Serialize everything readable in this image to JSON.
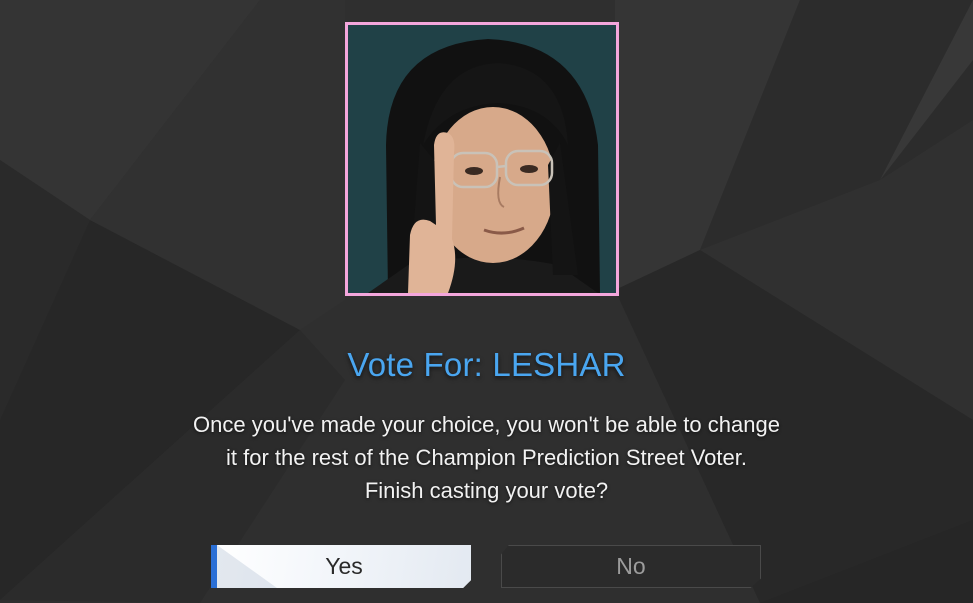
{
  "dialog": {
    "title": "Vote For: LESHAR",
    "message_lines": [
      "Once you've made your choice, you won't be able to change",
      "it for the rest of the Champion Prediction Street Voter.",
      "Finish casting your vote?"
    ],
    "buttons": {
      "yes_label": "Yes",
      "no_label": "No"
    }
  },
  "colors": {
    "background": "#2f2f2f",
    "title_accent": "#4aa6f0",
    "portrait_border": "#f4a6dc",
    "yes_button_bg": "#f4f7fb",
    "yes_button_accent": "#2a6fd6",
    "no_button_bg": "#2b2b2b"
  },
  "portrait": {
    "icon": "player-portrait"
  }
}
